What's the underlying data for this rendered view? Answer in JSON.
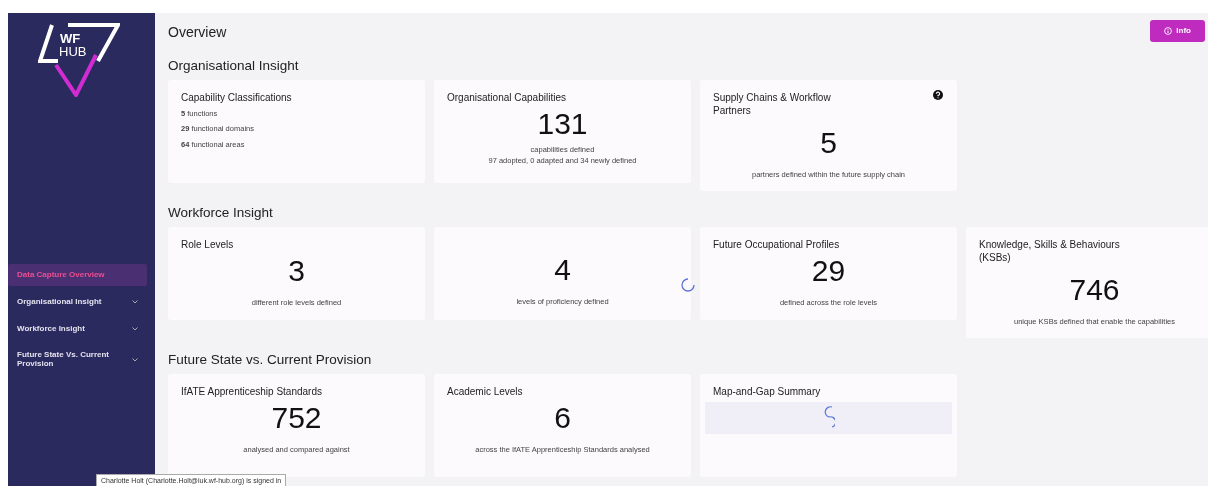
{
  "logo": {
    "lines": [
      "WF",
      "HUB"
    ]
  },
  "sidebar": {
    "items": [
      {
        "label": "Data Capture Overview",
        "selected": true,
        "expandable": false
      },
      {
        "label": "Organisational Insight",
        "selected": false,
        "expandable": true
      },
      {
        "label": "Workforce Insight",
        "selected": false,
        "expandable": true
      },
      {
        "label": "Future State Vs. Current Provision",
        "selected": false,
        "expandable": true
      }
    ]
  },
  "header": {
    "title": "Overview",
    "info_button": "Info"
  },
  "sections": [
    {
      "title": "Organisational Insight",
      "cards": [
        {
          "kind": "list",
          "title": "Capability Classifications",
          "help": false,
          "lines": [
            "**5** functions",
            "**29** functional domains",
            "**64** functional areas"
          ]
        },
        {
          "kind": "stat",
          "title": "Organisational Capabilities",
          "help": false,
          "value": "131",
          "lines": [
            "capabilities defined",
            "97 adopted, 0 adapted and 34 newly defined"
          ]
        },
        {
          "kind": "stat",
          "title": "Supply Chains & Workflow Partners",
          "help": true,
          "value": "5",
          "lines": [
            "partners defined within the future supply chain"
          ]
        }
      ]
    },
    {
      "title": "Workforce Insight",
      "cards": [
        {
          "kind": "stat",
          "title": "Role Levels",
          "help": false,
          "value": "3",
          "lines": [
            "different role levels defined"
          ]
        },
        {
          "kind": "stat",
          "help": false,
          "value": "4",
          "lines": [
            "levels of proficiency defined"
          ]
        },
        {
          "kind": "stat",
          "title": "Future Occupational Profiles",
          "help": false,
          "value": "29",
          "lines": [
            "defined across the role levels"
          ]
        },
        {
          "kind": "stat",
          "title": "Knowledge, Skills & Behaviours (KSBs)",
          "help": false,
          "value": "746",
          "lines": [
            "unique KSBs defined that enable the capabilities"
          ]
        }
      ]
    },
    {
      "title": "Future State vs. Current Provision",
      "cards": [
        {
          "kind": "stat",
          "title": "IfATE Apprenticeship Standards",
          "help": false,
          "value": "752",
          "lines": [
            "analysed and compared against"
          ]
        },
        {
          "kind": "stat",
          "title": "Academic Levels",
          "help": false,
          "value": "6",
          "lines": [
            "across the IfATE Apprenticeship Standards analysed"
          ]
        },
        {
          "kind": "loading",
          "title": "Map-and-Gap Summary",
          "help": false
        }
      ]
    }
  ],
  "tooltip": "Charlotte Holt (Charlotte.Holt@iuk.wf-hub.org) is signed in"
}
